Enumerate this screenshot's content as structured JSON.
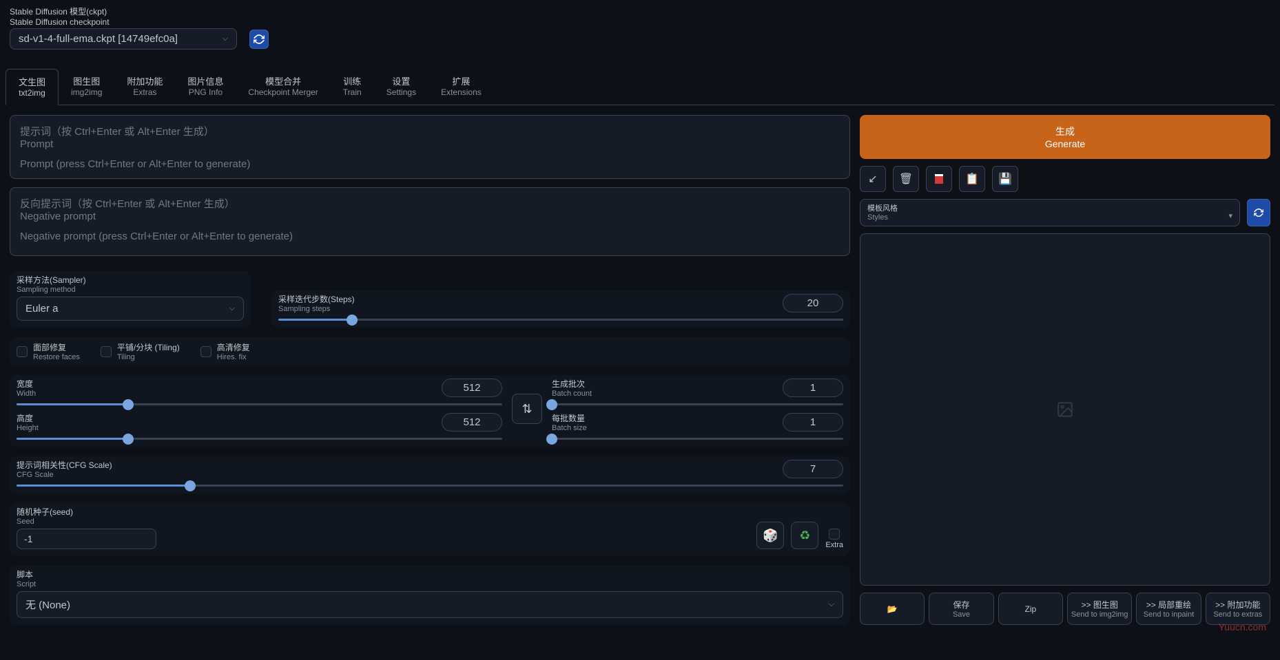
{
  "header": {
    "label_cn": "Stable Diffusion 模型(ckpt)",
    "label_en": "Stable Diffusion checkpoint",
    "checkpoint": "sd-v1-4-full-ema.ckpt [14749efc0a]"
  },
  "tabs": [
    {
      "cn": "文生图",
      "en": "txt2img",
      "active": true
    },
    {
      "cn": "图生图",
      "en": "img2img"
    },
    {
      "cn": "附加功能",
      "en": "Extras"
    },
    {
      "cn": "图片信息",
      "en": "PNG Info"
    },
    {
      "cn": "模型合并",
      "en": "Checkpoint Merger"
    },
    {
      "cn": "训练",
      "en": "Train"
    },
    {
      "cn": "设置",
      "en": "Settings"
    },
    {
      "cn": "扩展",
      "en": "Extensions"
    }
  ],
  "prompt": {
    "placeholder_cn": "提示词（按 Ctrl+Enter 或 Alt+Enter 生成）",
    "placeholder_en1": "Prompt",
    "placeholder_en2": "Prompt (press Ctrl+Enter or Alt+Enter to generate)"
  },
  "neg_prompt": {
    "placeholder_cn": "反向提示词（按 Ctrl+Enter 或 Alt+Enter 生成）",
    "placeholder_en1": "Negative prompt",
    "placeholder_en2": "Negative prompt (press Ctrl+Enter or Alt+Enter to generate)"
  },
  "generate": {
    "cn": "生成",
    "en": "Generate"
  },
  "styles": {
    "cn": "模板风格",
    "en": "Styles"
  },
  "sampler": {
    "label_cn": "采样方法(Sampler)",
    "label_en": "Sampling method",
    "value": "Euler a"
  },
  "steps": {
    "label_cn": "采样迭代步数(Steps)",
    "label_en": "Sampling steps",
    "value": "20",
    "percent": 13
  },
  "restore_faces": {
    "cn": "面部修复",
    "en": "Restore faces"
  },
  "tiling": {
    "cn": "平铺/分块 (Tiling)",
    "en": "Tiling"
  },
  "hires": {
    "cn": "高清修复",
    "en": "Hires. fix"
  },
  "width": {
    "cn": "宽度",
    "en": "Width",
    "value": "512",
    "percent": 23
  },
  "height": {
    "cn": "高度",
    "en": "Height",
    "value": "512",
    "percent": 23
  },
  "batch_count": {
    "cn": "生成批次",
    "en": "Batch count",
    "value": "1",
    "percent": 0
  },
  "batch_size": {
    "cn": "每批数量",
    "en": "Batch size",
    "value": "1",
    "percent": 0
  },
  "cfg": {
    "cn": "提示词相关性(CFG Scale)",
    "en": "CFG Scale",
    "value": "7",
    "percent": 21
  },
  "seed": {
    "cn": "随机种子(seed)",
    "en": "Seed",
    "value": "-1",
    "extra": "Extra"
  },
  "script": {
    "cn": "脚本",
    "en": "Script",
    "value": "无 (None)"
  },
  "output": {
    "folder": "📂",
    "save": {
      "cn": "保存",
      "en": "Save"
    },
    "zip": "Zip",
    "img2img": {
      "cn": ">> 图生图",
      "en": "Send to img2img"
    },
    "inpaint": {
      "cn": ">> 局部重绘",
      "en": "Send to inpaint"
    },
    "extras": {
      "cn": ">> 附加功能",
      "en": "Send to extras"
    }
  },
  "watermark": "Yuucn.com"
}
